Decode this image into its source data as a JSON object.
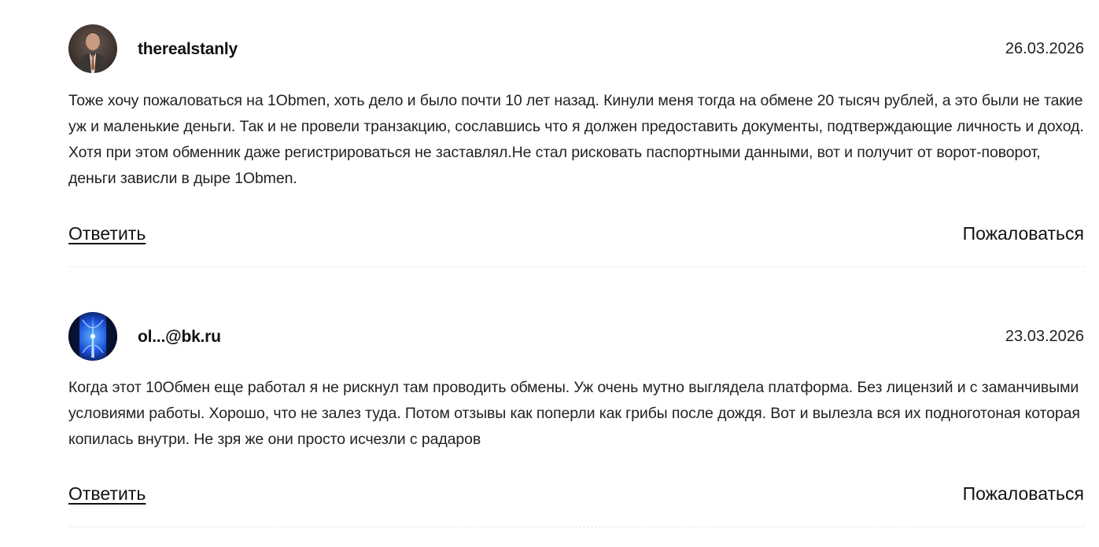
{
  "comments": [
    {
      "author": "therealstanly",
      "date": "26.03.2026",
      "text": "Тоже хочу пожаловаться на 1Obmen, хоть дело и было почти 10 лет назад. Кинули меня тогда на обмене 20 тысяч рублей, а это были не такие уж и маленькие деньги. Так и не провели транзакцию, сославшись что я должен предоставить документы, подтверждающие личность и доход. Хотя при этом обменник даже регистрироваться не заставлял.Не стал рисковать паспортными данными, вот и получит от ворот-поворот, деньги зависли в дыре 1Obmen.",
      "reply_label": "Ответить",
      "report_label": "Пожаловаться",
      "avatar_icon": "user-photo-avatar"
    },
    {
      "author": "ol...@bk.ru",
      "date": "23.03.2026",
      "text": "Когда этот 10Обмен еще работал я не рискнул там проводить обмены. Уж очень мутно выглядела платформа. Без лицензий и с заманчивыми условиями работы. Хорошо, что не залез туда. Потом отзывы как поперли как грибы после дождя. Вот и вылезла вся их подноготоная которая копилась внутри. Не зря же они просто исчезли с радаров",
      "reply_label": "Ответить",
      "report_label": "Пожаловаться",
      "avatar_icon": "blue-abstract-avatar"
    }
  ],
  "colors": {
    "text": "#222222",
    "divider": "#e4e4e4",
    "background": "#ffffff"
  }
}
